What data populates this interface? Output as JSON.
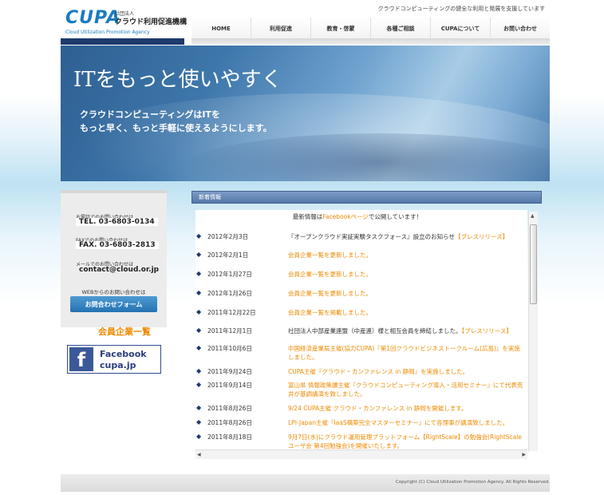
{
  "header": {
    "logo_cupa": "CUPA",
    "logo_houjin": "社団法人",
    "logo_jp": "クラウド利用促進機構",
    "logo_en": "Cloud Utilization Promotion Agency",
    "tagline": "クラウドコンピューティングの健全な利用と発展を支援しています"
  },
  "nav": [
    {
      "label": "HOME"
    },
    {
      "label": "利用促進"
    },
    {
      "label": "教育・啓蒙"
    },
    {
      "label": "各種ご相談"
    },
    {
      "label": "CUPAについて"
    },
    {
      "label": "お問い合わせ"
    }
  ],
  "hero": {
    "title": "ITをもっと使いやすく",
    "subtitle_line1": "クラウドコンピューティングはITを",
    "subtitle_line2": "もっと早く、もっと手軽に使えるようにします。"
  },
  "sidebar": {
    "phone_label": "お電話でのお問い合わせは",
    "phone_value": "TEL. 03-6803-0134",
    "fax_label": "FAXでのお問い合わせは",
    "fax_value": "FAX. 03-6803-2813",
    "mail_label": "メールでのお問い合わせは",
    "mail_value": "contact@cloud.or.jp",
    "web_label": "WEBからのお問い合わせは",
    "form_button": "お問合わせフォーム",
    "members_link": "会員企業一覧",
    "facebook_line1": "Facebook",
    "facebook_line2": "cupa.jp"
  },
  "news": {
    "header": "新着情報",
    "intro_before": "最新情報は",
    "intro_link": "Facebookページ",
    "intro_after": "で公開しています！",
    "items": [
      {
        "date": "2012年2月3日",
        "text": "『オープンクラウド実証実験タスクフォース』設立のお知らせ",
        "suffix": "【プレスリリース】"
      },
      {
        "date": "2012年2月1日",
        "text": "会員企業一覧を更新しました。",
        "suffix": ""
      },
      {
        "date": "2012年1月27日",
        "text": "会員企業一覧を更新しました。",
        "suffix": ""
      },
      {
        "date": "2012年1月26日",
        "text": "会員企業一覧を更新しました。",
        "suffix": ""
      },
      {
        "date": "2011年12月22日",
        "text": "会員企業一覧を掲載しました。",
        "suffix": ""
      },
      {
        "date": "2011年12月1日",
        "text": "社団法人中部産業連盟（中産連）様と相互会員を締結しました。",
        "suffix": "【プレスリリース】"
      },
      {
        "date": "2011年10月6日",
        "text": "中国経済産業局主催(協力CUPA)『第1回クラウドビジネストークルーム(広島)』を実施しました。",
        "suffix": ""
      },
      {
        "date": "2011年9月24日",
        "text": "CUPA主催『クラウド・カンファレンス in 静岡』を実施しました。",
        "suffix": ""
      },
      {
        "date": "2011年9月14日",
        "text": "富山県 情報政策課主催『クラウドコンピューティング導入・活用セミナー』にて代表荒井が基調講演を致しました。",
        "suffix": ""
      },
      {
        "date": "2011年8月26日",
        "text": "9/24 CUPA主催 クラウド・カンファレンス in 静岡を開催します。",
        "suffix": ""
      },
      {
        "date": "2011年8月26日",
        "text": "LPI-Japan主催『IaaS構築完全マスターセミナー』にて各理事が講演致しました。",
        "suffix": ""
      },
      {
        "date": "2011年8月18日",
        "text": "9月7日(水)にクラウド運用管理プラットフォーム【RightScale】の勉強会(RightScale ユーザ会 第4回勉強会)を開催いたします。",
        "suffix": ""
      }
    ]
  },
  "footer": {
    "copyright": "Copyright (C) Cloud Utilization Promotion Agency. All Rights Reserved."
  }
}
